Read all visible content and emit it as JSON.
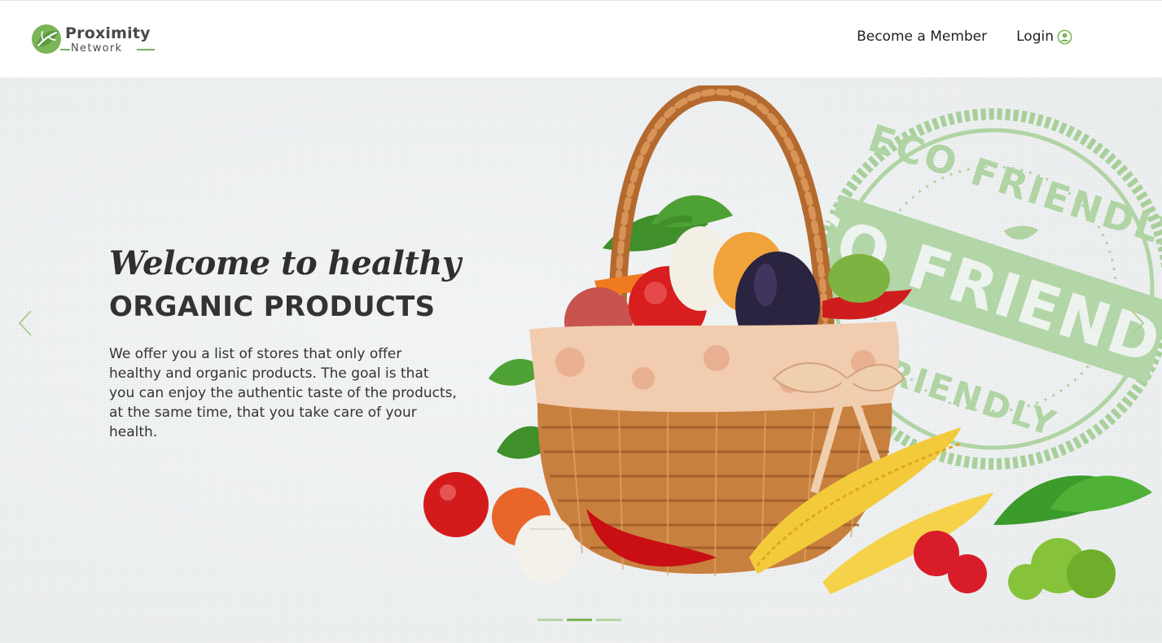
{
  "brand": {
    "name": "Proximity",
    "subname": "Network",
    "icon": "leaf-logo-icon",
    "accent_color": "#7ab557"
  },
  "nav": {
    "items": [
      {
        "label": "Become a Member"
      },
      {
        "label": "Login",
        "icon": "user-circle-icon"
      }
    ]
  },
  "hero": {
    "script_title": "Welcome to healthy",
    "title": "ORGANIC PRODUCTS",
    "description": "We offer you a list of stores that only offer healthy and organic products. The goal is that you can enjoy the authentic taste of the products, at the same time, that you take care of your health.",
    "stamp_text_top": "ECO FRIENDLY",
    "stamp_text_middle": "ECO FRIENDLY",
    "stamp_text_bottom": "FRIENDLY",
    "prev_icon": "chevron-left-icon",
    "next_icon": "chevron-right-icon"
  },
  "carousel": {
    "slide_count": 3,
    "active_slide": 2
  }
}
